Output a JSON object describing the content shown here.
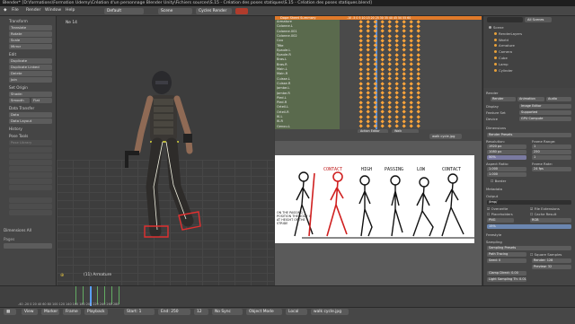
{
  "title_bar": "Blender* [D:\\formations\\Formation Udemy\\Création d'un personnage Blender Unity\\Fichiers sources\\S.15 - Création des poses statiques\\S.15 - Création des poses statiques.blend]",
  "menu": {
    "items": [
      "File",
      "Render",
      "Window",
      "Help"
    ],
    "layout": "Default",
    "scene": "Scene",
    "engine": "Cycles Render"
  },
  "toolshelf": {
    "sections": [
      {
        "header": "Transform",
        "items": [
          "Translate",
          "Rotate",
          "Scale",
          "Mirror"
        ]
      },
      {
        "header": "Edit",
        "items": [
          "Duplicate",
          "Duplicate Linked",
          "Delete",
          "Join"
        ]
      },
      {
        "header": "Set Origin",
        "items": [
          "Shade:",
          "Smooth",
          "Flat"
        ]
      },
      {
        "header": "Data Transfer",
        "items": [
          "Data",
          "Data Layout"
        ]
      },
      {
        "header": "History",
        "items": []
      },
      {
        "header": "Pose Tools",
        "items": [
          "Pose Library"
        ]
      }
    ],
    "last_op_header": "Dimensions All",
    "last_op_field": "Pages"
  },
  "viewport": {
    "label": "Ne 14",
    "frame_info": "(11) Armature"
  },
  "dope_sheet": {
    "summary": "Dope Sheet Summary",
    "channels": [
      "Armature",
      "Colonne.L",
      "Colonne.001",
      "Colonne.002",
      "Cou",
      "Tête",
      "Épaule.L",
      "Épaule.R",
      "Bras.L",
      "Bras.R",
      "Main.L",
      "Main.R",
      "Cuisse.L",
      "Cuisse.R",
      "Jambe.L",
      "Jambe.R",
      "Pied.L",
      "Pied.R",
      "Orteil.L",
      "Orteil.R",
      "IK.L",
      "IK.R",
      "Genou.L"
    ],
    "ruler": "-10 -5 0 5 10 15 20 25 30 35 40 45 50 55 60",
    "mode": "Action Editor",
    "action": "Walk"
  },
  "image_editor": {
    "image_name": "walk cycle.jpg",
    "labels": [
      "CONTACT",
      "HIGH",
      "PASSING",
      "LOW",
      "CONTACT"
    ],
    "note": "ON THE PASSING POSITION THE BODY IS AT HEIGHT OF THE STRIDE"
  },
  "outliner": {
    "items": [
      "Scene",
      "RenderLayers",
      "World",
      "Armature",
      "Camera",
      "Cube",
      "Lamp",
      "Cylinder"
    ],
    "header": "All Scenes",
    "search": ""
  },
  "properties": {
    "render_label": "Render",
    "buttons": [
      "Render",
      "Animation",
      "Audio"
    ],
    "display": "Image Editor",
    "feature_set": "Supported",
    "device": "GPU Compute",
    "dimensions_header": "Dimensions",
    "presets": "Render Presets",
    "resolution": {
      "x": "1920 px",
      "y": "1080 px",
      "pct": "50%"
    },
    "frame_range": {
      "start": "1",
      "end": "250",
      "step": "1"
    },
    "aspect": {
      "x": "1.000",
      "y": "1.000"
    },
    "frame_rate": "24 fps",
    "border": "Border",
    "sections": [
      "Metadata",
      "Output",
      "Freestyle",
      "Sampling"
    ],
    "output": {
      "path": "/tmp/",
      "overwrite": "Overwrite",
      "extensions": "File Extensions",
      "placeholders": "Placeholders",
      "cache": "Cache Result",
      "format": "PNG",
      "color": "RGB",
      "compression": "15%"
    },
    "sampling": {
      "preset": "Sampling Presets",
      "integrator": "Path Tracing",
      "square": "Square Samples",
      "seed": "Seed: 0",
      "render": "Render: 128",
      "preview": "Preview: 32",
      "clamp": "Clamp Direct: 0.00",
      "light": "Light Sampling Th: 0.01"
    }
  },
  "timeline": {
    "ruler": "-40 -20 0 20 40 60 80 100 120 140 160 180 200 220 240 260 280",
    "controls": [
      "View",
      "Marker",
      "Frame",
      "Playback"
    ],
    "start": "Start: 1",
    "end": "End: 250",
    "current": "12",
    "sync": "No Sync"
  },
  "statusbar": {
    "mode": "Object Mode",
    "pivot": "Local",
    "image": "walk cycle.jpg"
  }
}
